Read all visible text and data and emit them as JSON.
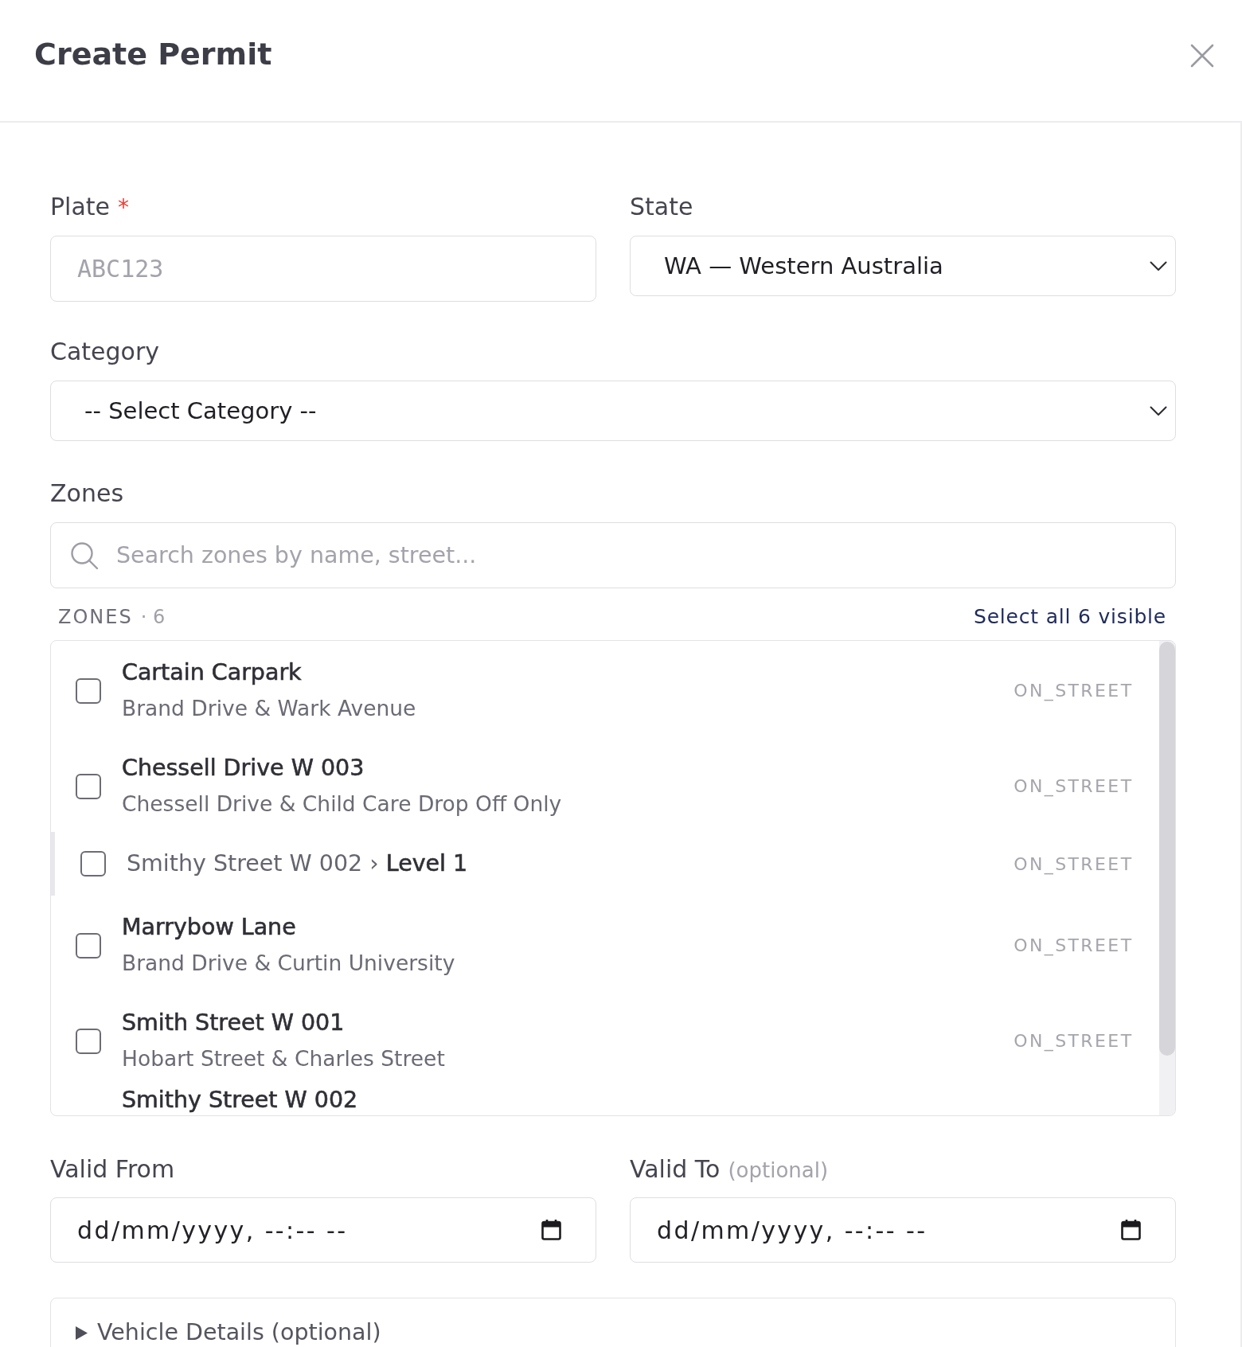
{
  "dialog": {
    "title": "Create Permit"
  },
  "plate": {
    "label": "Plate",
    "required_mark": "*",
    "placeholder": "ABC123"
  },
  "state": {
    "label": "State",
    "value": "WA — Western Australia"
  },
  "category": {
    "label": "Category",
    "value": "-- Select Category --"
  },
  "zones": {
    "label": "Zones",
    "search": {
      "placeholder": "Search zones by name, street..."
    },
    "list_label": "ZONES",
    "count": "· 6",
    "select_all": "Select all 6 visible",
    "items": [
      {
        "kind": "zone",
        "name": "Cartain Carpark",
        "address": "Brand Drive & Wark Avenue",
        "type": "ON_STREET",
        "checked": false
      },
      {
        "kind": "zone",
        "name": "Chessell Drive W 003",
        "address": "Chessell Drive & Child Care Drop Off Only",
        "type": "ON_STREET",
        "checked": false
      },
      {
        "kind": "level",
        "name": "Smithy Street W 002 › **Level 1**",
        "type": "ON_STREET",
        "checked": false
      },
      {
        "kind": "zone",
        "name": "Marrybow Lane",
        "address": "Brand Drive & Curtin University",
        "type": "ON_STREET",
        "checked": false
      },
      {
        "kind": "zone",
        "name": "Smith Street W 001",
        "address": "Hobart Street & Charles Street",
        "type": "ON_STREET",
        "checked": false
      },
      {
        "kind": "zone",
        "name": "Smithy Street W 002"
      }
    ]
  },
  "valid_from": {
    "label": "Valid From",
    "placeholder": "dd/mm/yyyy, --:-- --"
  },
  "valid_to": {
    "label": "Valid To",
    "hint": "(optional)",
    "placeholder": "dd/mm/yyyy, --:-- --"
  },
  "vehicle_details": {
    "label": "Vehicle Details (optional)",
    "expanded": false
  }
}
